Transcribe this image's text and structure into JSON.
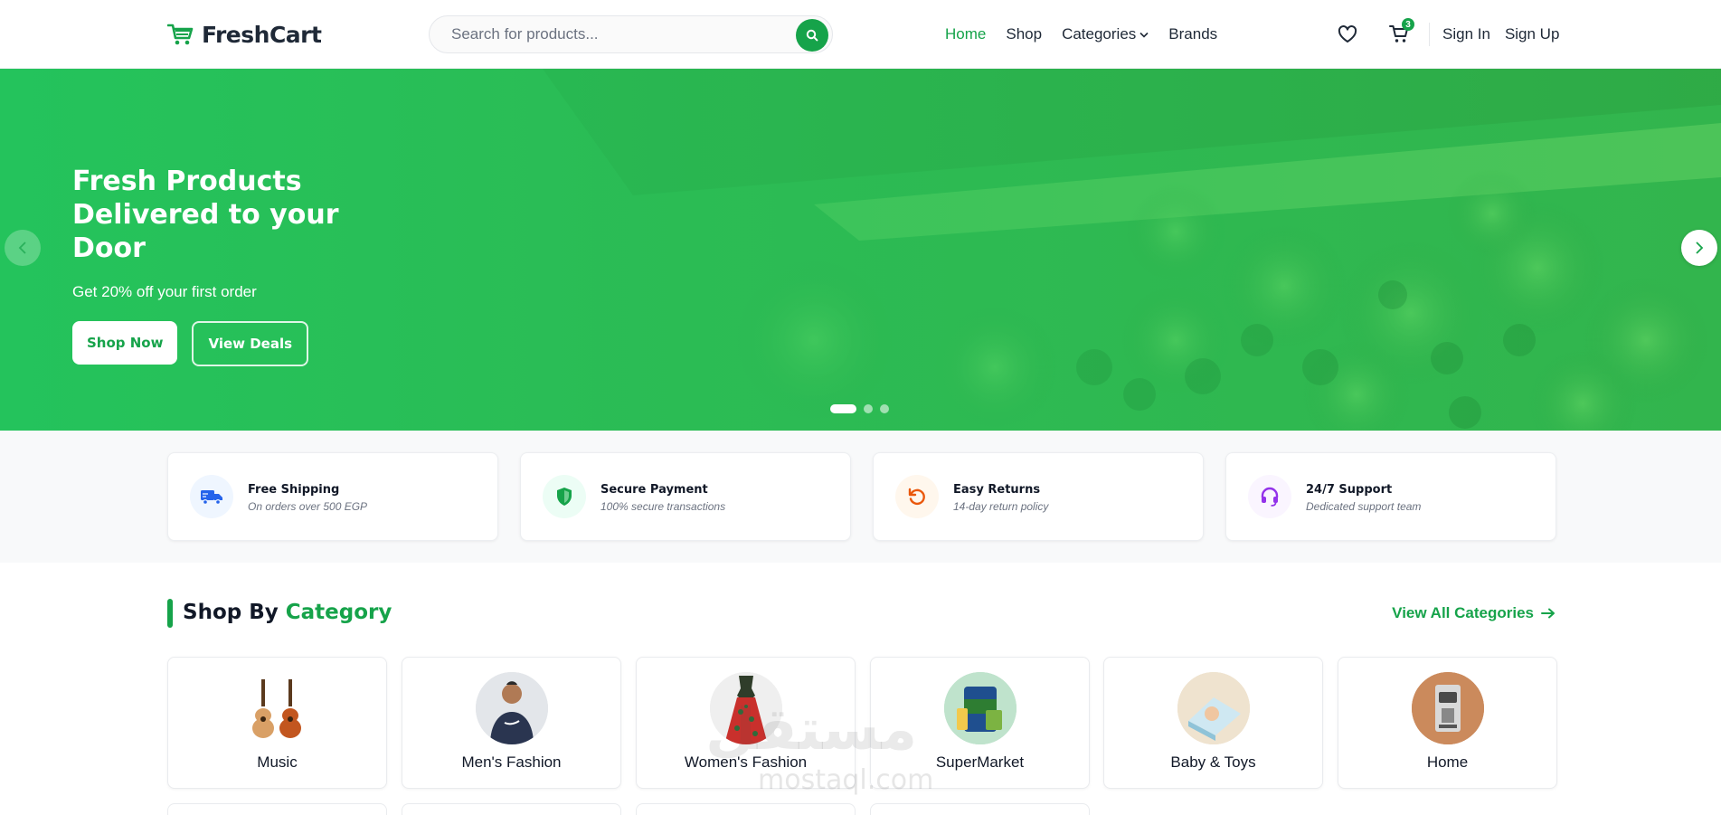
{
  "brand": {
    "name": "FreshCart",
    "accent": "#16a34a"
  },
  "search": {
    "placeholder": "Search for products..."
  },
  "nav": {
    "links": [
      {
        "label": "Home",
        "active": true
      },
      {
        "label": "Shop"
      },
      {
        "label": "Categories"
      },
      {
        "label": "Brands"
      }
    ],
    "cart_count": "3",
    "sign_in": "Sign In",
    "sign_up": "Sign Up"
  },
  "hero": {
    "title": "Fresh Products Delivered to your Door",
    "subtitle": "Get 20% off your first order",
    "primary_button": "Shop Now",
    "secondary_button": "View Deals",
    "slides": 3,
    "active_slide": 1
  },
  "features": [
    {
      "title": "Free Shipping",
      "desc": "On orders over 500 EGP",
      "icon": "truck-icon",
      "color": "#2563eb",
      "bg": "#eff6ff"
    },
    {
      "title": "Secure Payment",
      "desc": "100% secure transactions",
      "icon": "shield-icon",
      "color": "#16a34a",
      "bg": "#ecfdf5"
    },
    {
      "title": "Easy Returns",
      "desc": "14-day return policy",
      "icon": "return-icon",
      "color": "#ea580c",
      "bg": "#fff7ed"
    },
    {
      "title": "24/7 Support",
      "desc": "Dedicated support team",
      "icon": "headset-icon",
      "color": "#9333ea",
      "bg": "#faf5ff"
    }
  ],
  "categories": {
    "title_prefix": "Shop By",
    "title_accent": "Category",
    "view_all": "View All Categories",
    "items": [
      {
        "name": "Music"
      },
      {
        "name": "Men's Fashion"
      },
      {
        "name": "Women's Fashion"
      },
      {
        "name": "SuperMarket"
      },
      {
        "name": "Baby & Toys"
      },
      {
        "name": "Home"
      }
    ]
  },
  "watermark": {
    "text": "مستقل",
    "sub": "mostaql.com"
  }
}
